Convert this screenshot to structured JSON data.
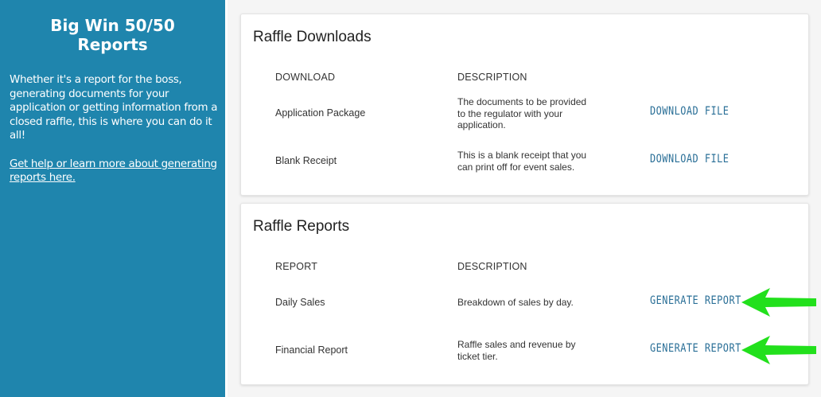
{
  "sidebar": {
    "title": "Big Win 50/50 Reports",
    "description": "Whether it's a report for the boss, generating documents for your application or getting information from a closed raffle, this is where you can do it all!",
    "help_link": "Get help or learn more about generating reports here."
  },
  "downloads": {
    "title": "Raffle Downloads",
    "col_name": "DOWNLOAD",
    "col_desc": "DESCRIPTION",
    "rows": [
      {
        "name": "Application Package",
        "description": "The documents to be provided to the regulator with your application.",
        "action": "DOWNLOAD FILE"
      },
      {
        "name": "Blank Receipt",
        "description": "This is a blank receipt that you can print off for event sales.",
        "action": "DOWNLOAD FILE"
      }
    ]
  },
  "reports": {
    "title": "Raffle Reports",
    "col_name": "REPORT",
    "col_desc": "DESCRIPTION",
    "rows": [
      {
        "name": "Daily Sales",
        "description": "Breakdown of sales by day.",
        "action": "GENERATE REPORT"
      },
      {
        "name": "Financial Report",
        "description": "Raffle sales and revenue by ticket tier.",
        "action": "GENERATE REPORT"
      }
    ]
  },
  "colors": {
    "sidebar_bg": "#1f85ad",
    "link": "#2a6f97",
    "arrow": "#22e01c"
  },
  "icons": [
    "green-arrow-icon"
  ]
}
